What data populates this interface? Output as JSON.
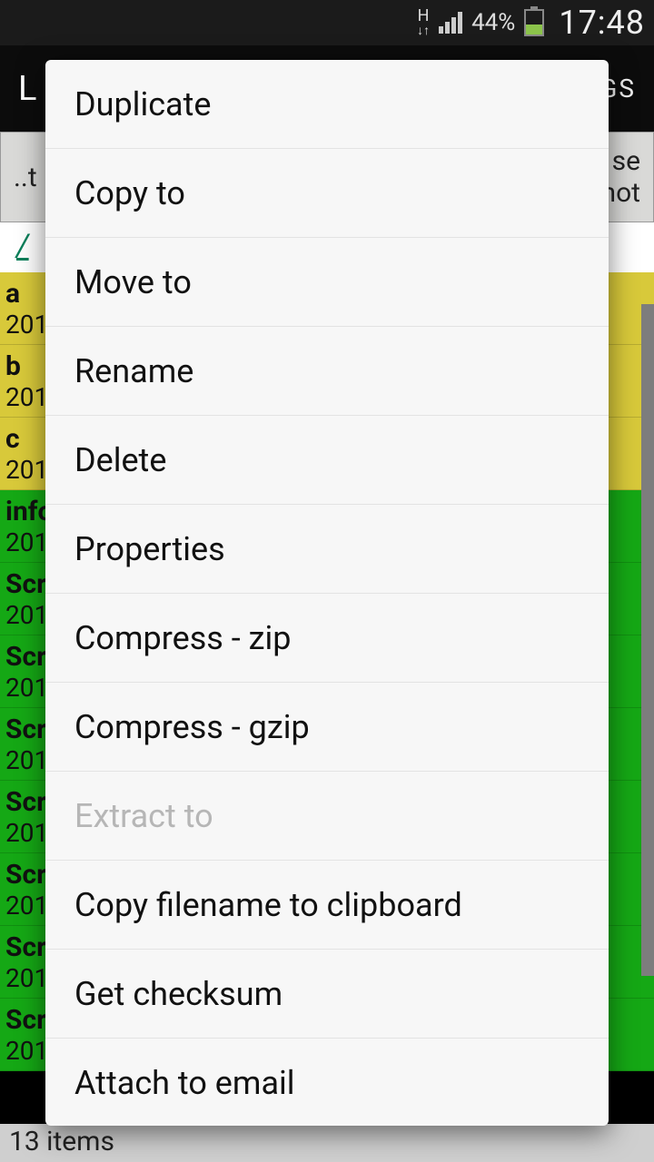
{
  "status": {
    "network_label": "H",
    "battery_percent": "44%",
    "clock": "17:48"
  },
  "header": {
    "title_fragment_left": "L",
    "title_fragment_right": "GS"
  },
  "toolbar": {
    "left_fragment": "..t",
    "right_top": "se",
    "right_bottom": "shot"
  },
  "breadcrumb": {
    "path": "/"
  },
  "files": [
    {
      "name": "a",
      "date": "201",
      "cls": "sel-yellow"
    },
    {
      "name": "b",
      "date": "201",
      "cls": "sel-yellow"
    },
    {
      "name": "c",
      "date": "201",
      "cls": "sel-yellow"
    },
    {
      "name": "info",
      "date": "201",
      "cls": "sel-green"
    },
    {
      "name": "Scr",
      "date": "201",
      "cls": "sel-green"
    },
    {
      "name": "Scr",
      "date": "201",
      "cls": "sel-green"
    },
    {
      "name": "Scr",
      "date": "201",
      "cls": "sel-green"
    },
    {
      "name": "Scr",
      "date": "201",
      "cls": "sel-green"
    },
    {
      "name": "Scr",
      "date": "201",
      "cls": "sel-green"
    },
    {
      "name": "Scr",
      "date": "201",
      "cls": "sel-green"
    },
    {
      "name": "Scr",
      "date": "201",
      "cls": "sel-green"
    }
  ],
  "footer": {
    "text": "13 items"
  },
  "menu": {
    "items": [
      {
        "label": "Duplicate",
        "enabled": true
      },
      {
        "label": "Copy to",
        "enabled": true
      },
      {
        "label": "Move to",
        "enabled": true
      },
      {
        "label": "Rename",
        "enabled": true
      },
      {
        "label": "Delete",
        "enabled": true
      },
      {
        "label": "Properties",
        "enabled": true
      },
      {
        "label": "Compress - zip",
        "enabled": true
      },
      {
        "label": "Compress - gzip",
        "enabled": true
      },
      {
        "label": "Extract to",
        "enabled": false
      },
      {
        "label": "Copy filename to clipboard",
        "enabled": true
      },
      {
        "label": "Get checksum",
        "enabled": true
      },
      {
        "label": "Attach to email",
        "enabled": true
      }
    ]
  }
}
